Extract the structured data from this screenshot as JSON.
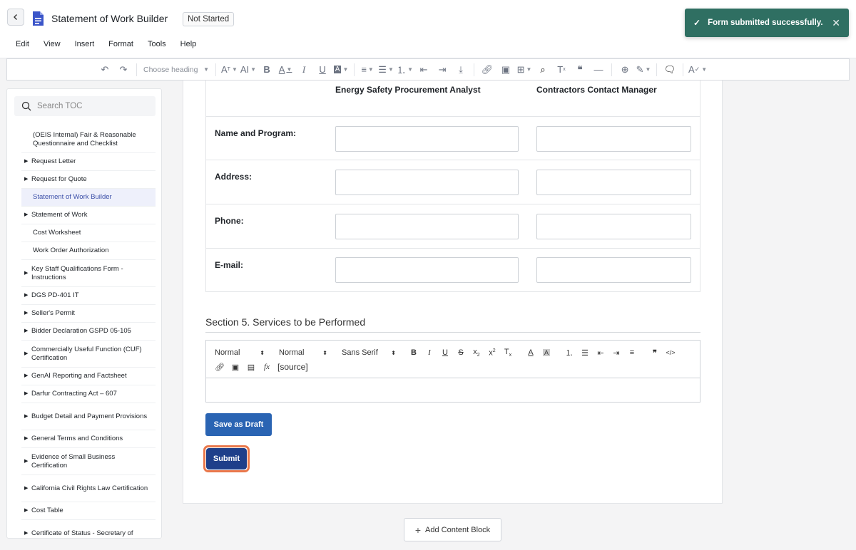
{
  "header": {
    "title": "Statement of Work Builder",
    "status": "Not Started",
    "menus": [
      "Edit",
      "View",
      "Insert",
      "Format",
      "Tools",
      "Help"
    ]
  },
  "toolbar": {
    "heading_placeholder": "Choose heading"
  },
  "toast": {
    "message": "Form submitted successfully."
  },
  "sidebar": {
    "search_placeholder": "Search TOC",
    "items": [
      {
        "label": "(OEIS Internal) Fair & Reasonable Questionnaire and Checklist",
        "arrow": false
      },
      {
        "label": "Request Letter",
        "arrow": true
      },
      {
        "label": "Request for Quote",
        "arrow": true
      },
      {
        "label": "Statement of Work Builder",
        "arrow": false,
        "active": true
      },
      {
        "label": "Statement of Work",
        "arrow": true
      },
      {
        "label": "Cost Worksheet",
        "arrow": false
      },
      {
        "label": "Work Order Authorization",
        "arrow": false
      },
      {
        "label": "Key Staff Qualifications Form - Instructions",
        "arrow": true
      },
      {
        "label": "DGS PD-401 IT",
        "arrow": true
      },
      {
        "label": "Seller's Permit",
        "arrow": true
      },
      {
        "label": "Bidder Declaration GSPD 05-105",
        "arrow": true
      },
      {
        "label": "Commercially Useful Function (CUF) Certification",
        "arrow": true
      },
      {
        "label": "GenAI Reporting and Factsheet",
        "arrow": true
      },
      {
        "label": "Darfur Contracting Act – 607",
        "arrow": true
      },
      {
        "label": "Budget Detail and Payment Provisions",
        "arrow": true
      },
      {
        "label": "General Terms and Conditions",
        "arrow": true
      },
      {
        "label": "Evidence of Small Business Certification",
        "arrow": true
      },
      {
        "label": "California Civil Rights Law Certification",
        "arrow": true
      },
      {
        "label": "Cost Table",
        "arrow": true
      },
      {
        "label": "Certificate of Status - Secretary of",
        "arrow": true
      }
    ]
  },
  "form": {
    "col1": "Energy Safety Procurement Analyst",
    "col2": "Contractors Contact Manager",
    "rows": [
      "Name and Program:",
      "Address:",
      "Phone:",
      "E-mail:"
    ]
  },
  "section5": {
    "title": "Section 5. Services to be Performed",
    "editor": {
      "select1": "Normal",
      "select2": "Normal",
      "select3": "Sans Serif",
      "source_label": "[source]"
    }
  },
  "buttons": {
    "save_draft": "Save as Draft",
    "submit": "Submit",
    "add_block": "Add Content Block"
  }
}
